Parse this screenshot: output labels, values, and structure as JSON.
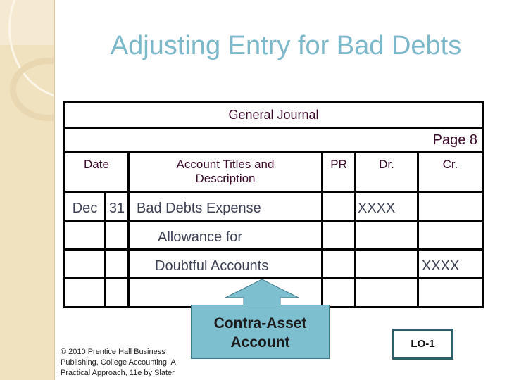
{
  "slide": {
    "title": "Adjusting Entry for Bad Debts"
  },
  "journal": {
    "heading": "General Journal",
    "page_label": "Page 8",
    "columns": {
      "date": "Date",
      "account": "Account Titles and Description",
      "pr": "PR",
      "debit": "Dr.",
      "credit": "Cr."
    },
    "rows": [
      {
        "month": "Dec",
        "day": "31",
        "account": "Bad Debts Expense",
        "pr": "",
        "debit": "XXXX",
        "credit": ""
      },
      {
        "month": "",
        "day": "",
        "account": "Allowance for",
        "pr": "",
        "debit": "",
        "credit": ""
      },
      {
        "month": "",
        "day": "",
        "account": "Doubtful Accounts",
        "pr": "",
        "debit": "",
        "credit": "XXXX"
      },
      {
        "month": "",
        "day": "",
        "account": "",
        "pr": "",
        "debit": "",
        "credit": ""
      }
    ]
  },
  "callout": {
    "line1": "Contra-Asset",
    "line2": "Account",
    "color": "#7dbfcf",
    "icon": "arrow-up-icon"
  },
  "footer": {
    "copyright": "© 2010 Prentice Hall Business Publishing, College Accounting: A Practical Approach, 11e by Slater",
    "lo_badge": "LO-1"
  },
  "colors": {
    "title": "#7bb8c9",
    "header_text": "#3b0a2a",
    "body_text": "#3e4255",
    "sidebar": "#f1e2bf"
  }
}
